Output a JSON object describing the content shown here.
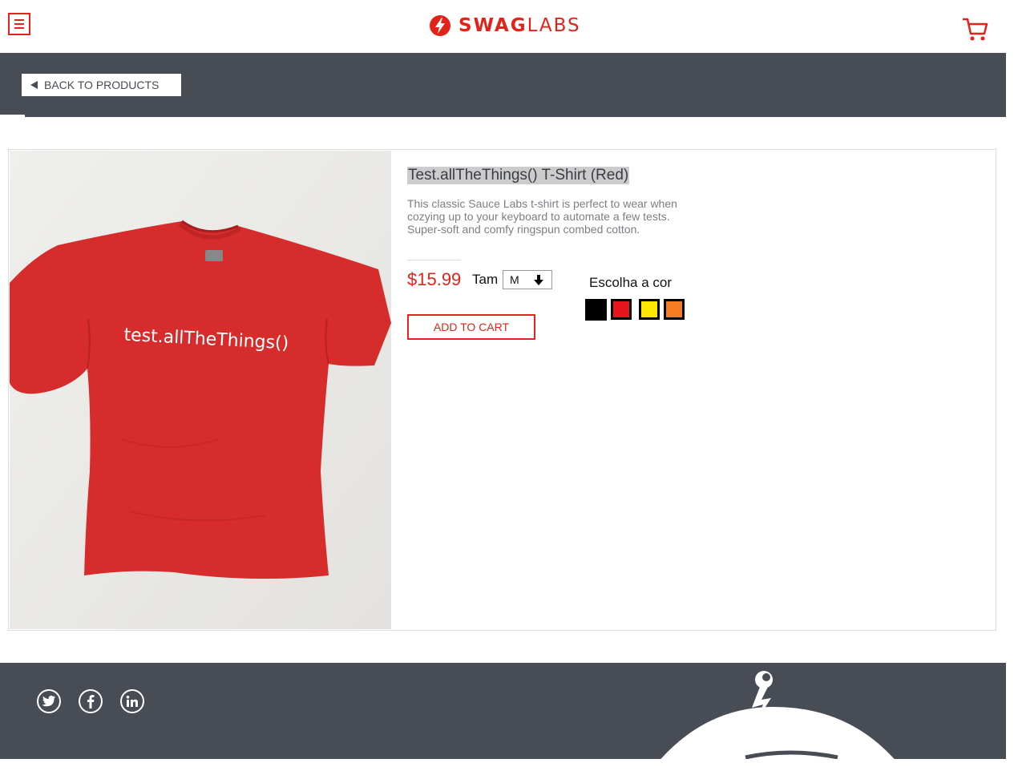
{
  "header": {
    "logo_bold": "SWAG",
    "logo_light": "LABS",
    "menu_icon": "hamburger-menu-icon",
    "cart_icon": "shopping-cart-icon"
  },
  "nav": {
    "back_label": "BACK TO PRODUCTS",
    "back_icon": "triangle-left-icon"
  },
  "product": {
    "image_caption": "test.allTheThings()",
    "title": "Test.allTheThings() T-Shirt (Red)",
    "description": "This classic Sauce Labs t-shirt is perfect to wear when cozying up to your keyboard to automate a few tests. Super-soft and comfy ringspun combed cotton.",
    "price": "$15.99",
    "size_label": "Tam",
    "size_value": "M",
    "color_label": "Escolha a cor",
    "colors": [
      "#000000",
      "#e8161b",
      "#ffe800",
      "#f57c20"
    ],
    "add_to_cart_label": "ADD TO CART"
  },
  "footer": {
    "social": [
      "twitter-icon",
      "facebook-icon",
      "linkedin-icon"
    ]
  },
  "colors": {
    "accent": "#e2231a",
    "dark_bar": "#484c55",
    "shirt": "#d42a2a"
  }
}
